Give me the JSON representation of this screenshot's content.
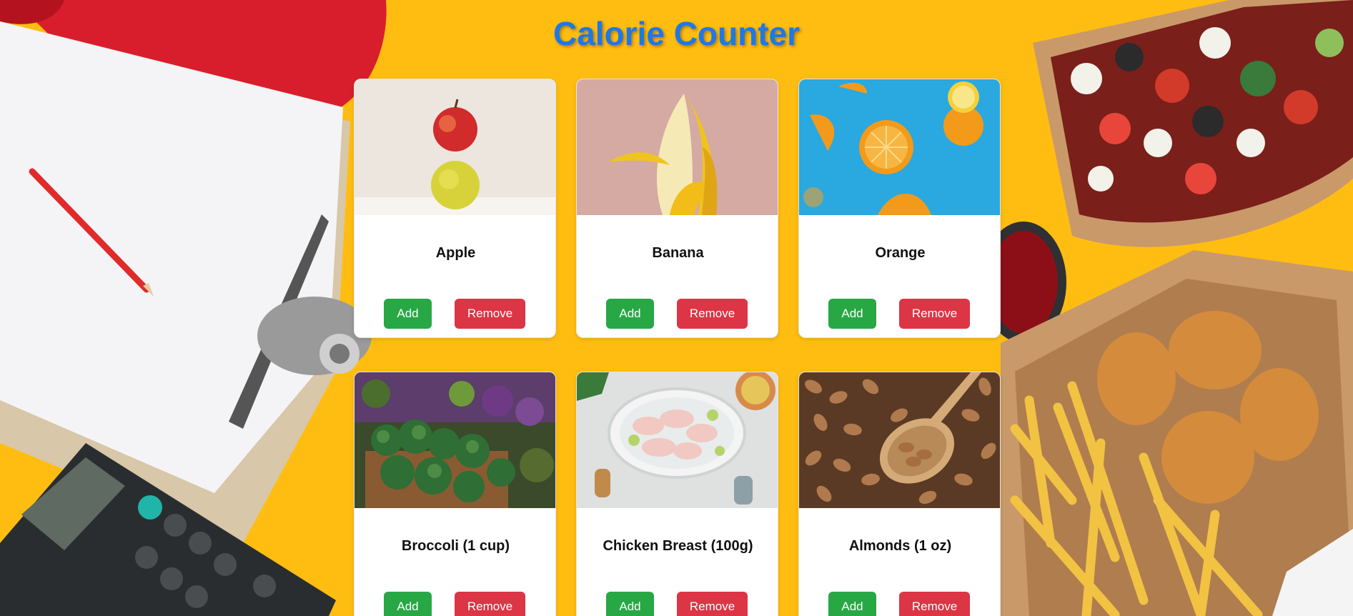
{
  "page": {
    "title": "Calorie Counter"
  },
  "foods": [
    {
      "name": "Apple",
      "image_icon": "apple-photo",
      "add_label": "Add",
      "remove_label": "Remove"
    },
    {
      "name": "Banana",
      "image_icon": "banana-photo",
      "add_label": "Add",
      "remove_label": "Remove"
    },
    {
      "name": "Orange",
      "image_icon": "orange-photo",
      "add_label": "Add",
      "remove_label": "Remove"
    },
    {
      "name": "Broccoli (1 cup)",
      "image_icon": "broccoli-photo",
      "add_label": "Add",
      "remove_label": "Remove"
    },
    {
      "name": "Chicken Breast (100g)",
      "image_icon": "chicken-photo",
      "add_label": "Add",
      "remove_label": "Remove"
    },
    {
      "name": "Almonds (1 oz)",
      "image_icon": "almonds-photo",
      "add_label": "Add",
      "remove_label": "Remove"
    }
  ],
  "colors": {
    "title": "#1e78e6",
    "background": "#ffbd12",
    "add_button": "#28a745",
    "remove_button": "#dc3545"
  }
}
